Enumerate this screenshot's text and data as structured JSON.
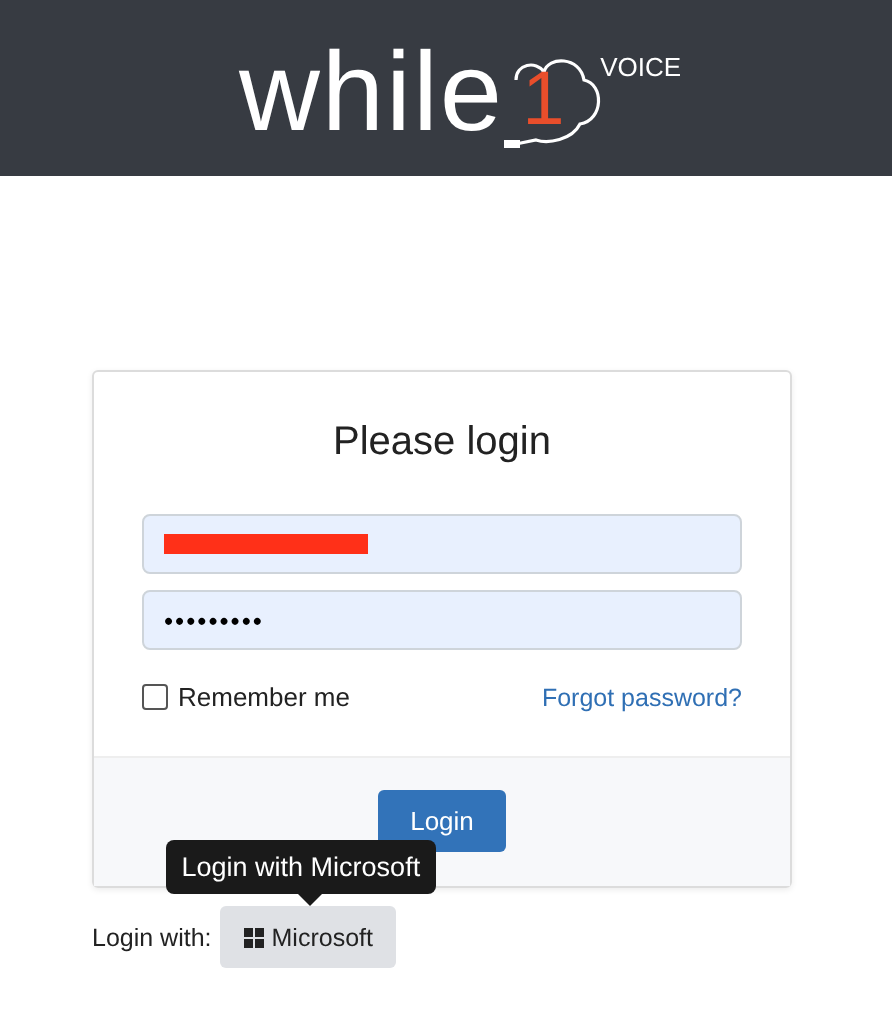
{
  "header": {
    "logo": {
      "word": "while",
      "digit": "1",
      "tag": "VOICE"
    }
  },
  "login_card": {
    "title": "Please login",
    "username": {
      "redacted": true
    },
    "password": {
      "value": "•••••••••"
    },
    "remember": {
      "label": "Remember me",
      "checked": false
    },
    "forgot_link": "Forgot password?",
    "submit": "Login"
  },
  "tooltip": "Login with Microsoft",
  "alt_login": {
    "label": "Login with:",
    "button": "Microsoft"
  }
}
